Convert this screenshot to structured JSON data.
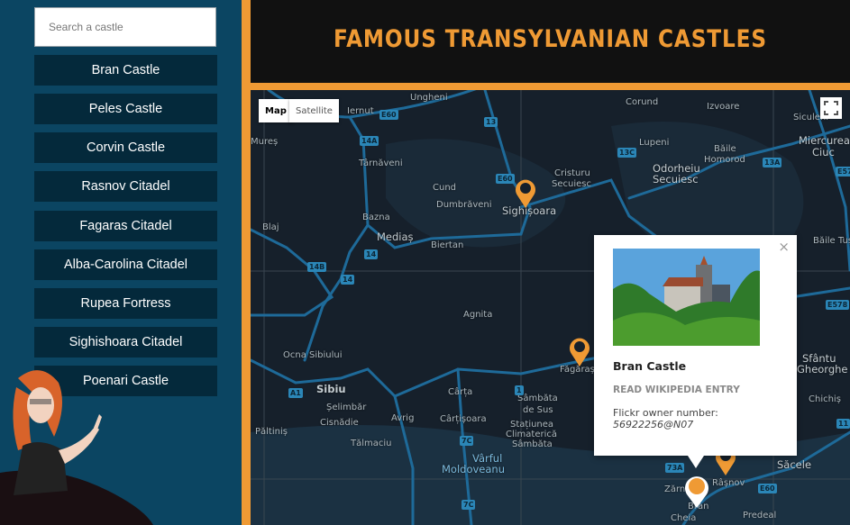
{
  "search": {
    "placeholder": "Search a castle",
    "value": ""
  },
  "castles": [
    "Bran Castle",
    "Peles Castle",
    "Corvin Castle",
    "Rasnov Citadel",
    "Fagaras Citadel",
    "Alba-Carolina Citadel",
    "Rupea Fortress",
    "Sighishoara Citadel",
    "Poenari Castle"
  ],
  "header": {
    "title": "FAMOUS TRANSYLVANIAN CASTLES"
  },
  "map": {
    "type_buttons": {
      "map": "Map",
      "satellite": "Satellite"
    },
    "fullscreen_icon": "fullscreen-icon",
    "labels": [
      "Ungheni",
      "Iernut",
      "Mureș",
      "Târnăveni",
      "Cund",
      "Dumbrăveni",
      "Sighișoara",
      "Bazna",
      "Mediaș",
      "Biertan",
      "Blaj",
      "Cristuru",
      "Secuiesc",
      "Corund",
      "Izvoare",
      "Siculeni",
      "Lupeni",
      "Băile",
      "Homorod",
      "Odorheiu",
      "Secuiesc",
      "Miercurea",
      "Ciuc",
      "Băile Tuș",
      "Agnita",
      "Ocna Sibiului",
      "Sibiu",
      "Șelimbăr",
      "Cisnădie",
      "Păltiniș",
      "Avrig",
      "Cârța",
      "Cârțișoara",
      "Sâmbăta",
      "de Sus",
      "Stațiunea",
      "Climaterică",
      "Sâmbăta",
      "Vârful",
      "Moldoveanu",
      "Făgăraș",
      "Tălmaciu",
      "Sfântu",
      "Gheorghe",
      "Chichiș",
      "Săcele",
      "Râșnov",
      "Zărnești",
      "Bran",
      "Predeal",
      "Cheia"
    ],
    "road_shields": [
      "E60",
      "13",
      "14A",
      "E60",
      "14",
      "14B",
      "14",
      "A1",
      "1",
      "7C",
      "7C",
      "13C",
      "13A",
      "E57",
      "E578",
      "73A",
      "E60",
      "11"
    ]
  },
  "popup": {
    "title": "Bran Castle",
    "link": "READ WIKIPEDIA ENTRY",
    "owner_label": "Flickr owner number:",
    "owner_value": "56922256@N07",
    "close": "×"
  },
  "colors": {
    "accent": "#ef9a34",
    "sidebar": "#0b4562",
    "item": "#04293b",
    "header": "#111111"
  }
}
